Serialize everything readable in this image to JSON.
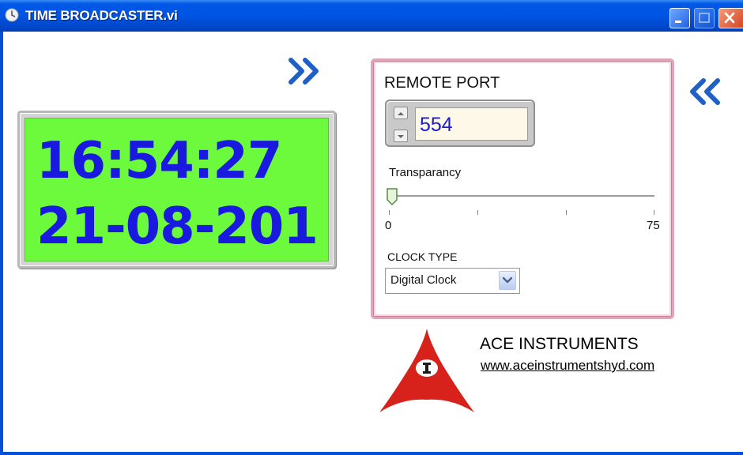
{
  "window": {
    "title": "TIME BROADCASTER.vi",
    "icon": "clock-icon",
    "controls": [
      "minimize-icon",
      "maximize-icon",
      "close-icon"
    ]
  },
  "clock": {
    "time": "16:54:27",
    "date": "21-08-201",
    "background_color": "#6df93c",
    "text_color": "#1919e0"
  },
  "navigation": {
    "forward_icon": "double-chevron-right-icon",
    "back_icon": "double-chevron-left-icon"
  },
  "settings": {
    "remote_port_label": "REMOTE PORT",
    "remote_port_value": "554",
    "transparency_label": "Transparancy",
    "transparency_min": "0",
    "transparency_max": "75",
    "transparency_value": 0,
    "clock_type_label": "CLOCK TYPE",
    "clock_type_value": "Digital Clock"
  },
  "branding": {
    "name": "ACE INSTRUMENTS",
    "url": "www.aceinstrumentshyd.com",
    "logo_color": "#d7211b"
  }
}
